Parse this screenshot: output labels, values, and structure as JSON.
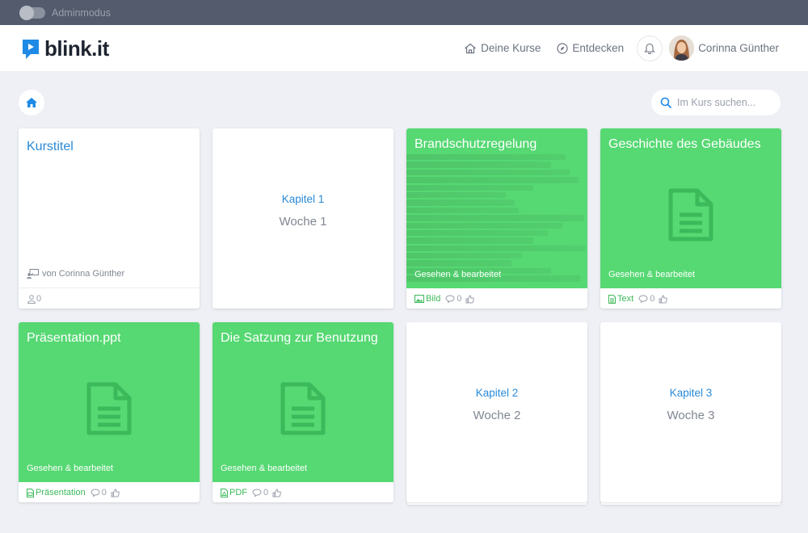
{
  "admin": {
    "label": "Adminmodus"
  },
  "brand": {
    "name": "blink.it",
    "accent": "#1f8ae5",
    "green": "#56d873"
  },
  "nav": {
    "courses": "Deine Kurse",
    "discover": "Entdecken",
    "user_name": "Corinna Günther"
  },
  "search": {
    "placeholder": "Im Kurs suchen..."
  },
  "kurs": {
    "title": "Kurstitel",
    "author": "von Corinna Günther",
    "participants": "0"
  },
  "chapters": [
    {
      "chapter": "Kapitel 1",
      "week": "Woche 1"
    },
    {
      "chapter": "Kapitel 2",
      "week": "Woche 2"
    },
    {
      "chapter": "Kapitel 3",
      "week": "Woche 3"
    }
  ],
  "items": [
    {
      "title": "Brandschutzregelung",
      "status": "Gesehen & bearbeitet",
      "type": "Bild",
      "comments": "0",
      "icon": "image-icon"
    },
    {
      "title": "Geschichte des Gebäudes",
      "status": "Gesehen & bearbeitet",
      "type": "Text",
      "comments": "0",
      "icon": "text-file-icon"
    },
    {
      "title": "Präsentation.ppt",
      "status": "Gesehen & bearbeitet",
      "type": "Präsentation",
      "comments": "0",
      "icon": "presentation-icon"
    },
    {
      "title": "Die Satzung zur Benutzung",
      "status": "Gesehen & bearbeitet",
      "type": "PDF",
      "comments": "0",
      "icon": "pdf-icon"
    }
  ]
}
